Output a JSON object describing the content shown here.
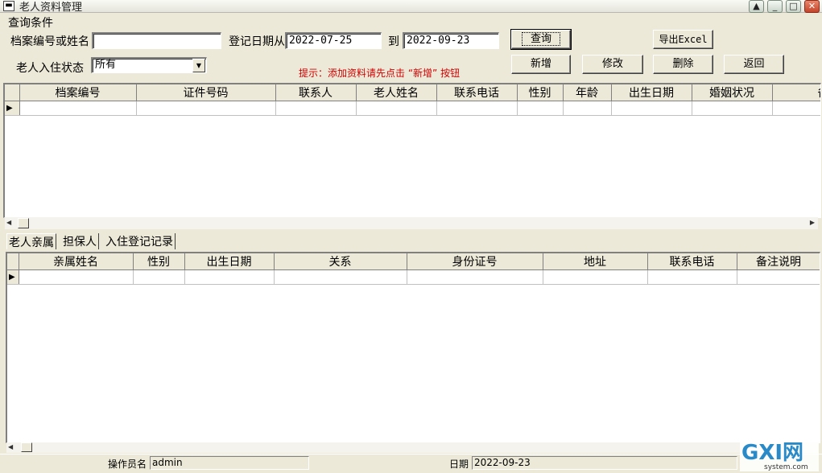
{
  "window": {
    "title": "老人资料管理"
  },
  "query": {
    "group_label": "查询条件",
    "id_or_name_label": "档案编号或姓名",
    "id_or_name_value": "",
    "date_from_label": "登记日期从",
    "date_from_value": "2022-07-25",
    "date_to_label": "到",
    "date_to_value": "2022-09-23",
    "status_label": "老人入住状态",
    "status_value": "所有",
    "hint": "提示：添加资料请先点击 “新增” 按钮"
  },
  "buttons": {
    "query": "查询",
    "export": "导出Excel",
    "add": "新增",
    "edit": "修改",
    "delete": "删除",
    "back": "返回"
  },
  "main_grid": {
    "columns": [
      "档案编号",
      "证件号码",
      "联系人",
      "老人姓名",
      "联系电话",
      "性别",
      "年龄",
      "出生日期",
      "婚姻状况",
      "备注"
    ]
  },
  "tabs": [
    "老人亲属",
    "担保人",
    "入住登记记录"
  ],
  "sub_grid": {
    "columns": [
      "亲属姓名",
      "性别",
      "出生日期",
      "关系",
      "身份证号",
      "地址",
      "联系电话",
      "备注说明"
    ]
  },
  "statusbar": {
    "operator_label": "操作员名",
    "operator_value": "admin",
    "date_label": "日期",
    "date_value": "2022-09-23"
  },
  "watermark": {
    "text_big": "GXI网",
    "text_small": "system.com"
  }
}
